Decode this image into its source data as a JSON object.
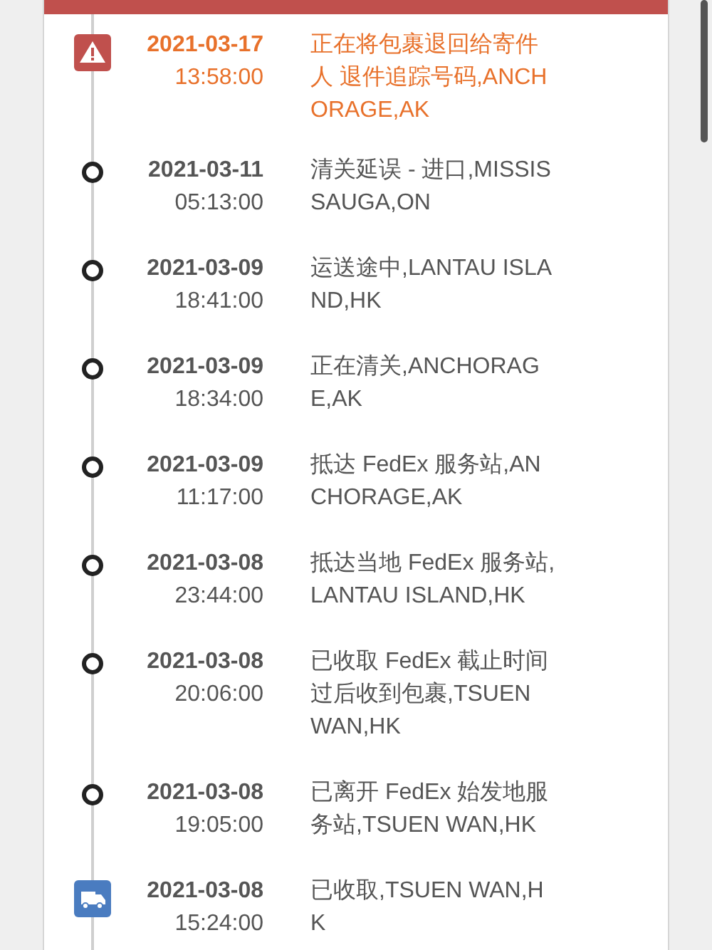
{
  "events": [
    {
      "kind": "exception",
      "date": "2021-03-17",
      "time": "13:58:00",
      "description": "正在将包裹退回给寄件人 退件追踪号码,ANCHORAGE,AK"
    },
    {
      "kind": "scan",
      "date": "2021-03-11",
      "time": "05:13:00",
      "description": "清关延误 - 进口,MISSISSAUGA,ON"
    },
    {
      "kind": "scan",
      "date": "2021-03-09",
      "time": "18:41:00",
      "description": "运送途中,LANTAU ISLAND,HK"
    },
    {
      "kind": "scan",
      "date": "2021-03-09",
      "time": "18:34:00",
      "description": "正在清关,ANCHORAGE,AK"
    },
    {
      "kind": "scan",
      "date": "2021-03-09",
      "time": "11:17:00",
      "description": "抵达 FedEx 服务站,ANCHORAGE,AK"
    },
    {
      "kind": "scan",
      "date": "2021-03-08",
      "time": "23:44:00",
      "description": "抵达当地 FedEx 服务站,LANTAU ISLAND,HK"
    },
    {
      "kind": "scan",
      "date": "2021-03-08",
      "time": "20:06:00",
      "description": "已收取 FedEx 截止时间过后收到包裹,TSUEN WAN,HK"
    },
    {
      "kind": "scan",
      "date": "2021-03-08",
      "time": "19:05:00",
      "description": "已离开 FedEx 始发地服务站,TSUEN WAN,HK"
    },
    {
      "kind": "pickup",
      "date": "2021-03-08",
      "time": "15:24:00",
      "description": "已收取,TSUEN WAN,HK"
    }
  ]
}
